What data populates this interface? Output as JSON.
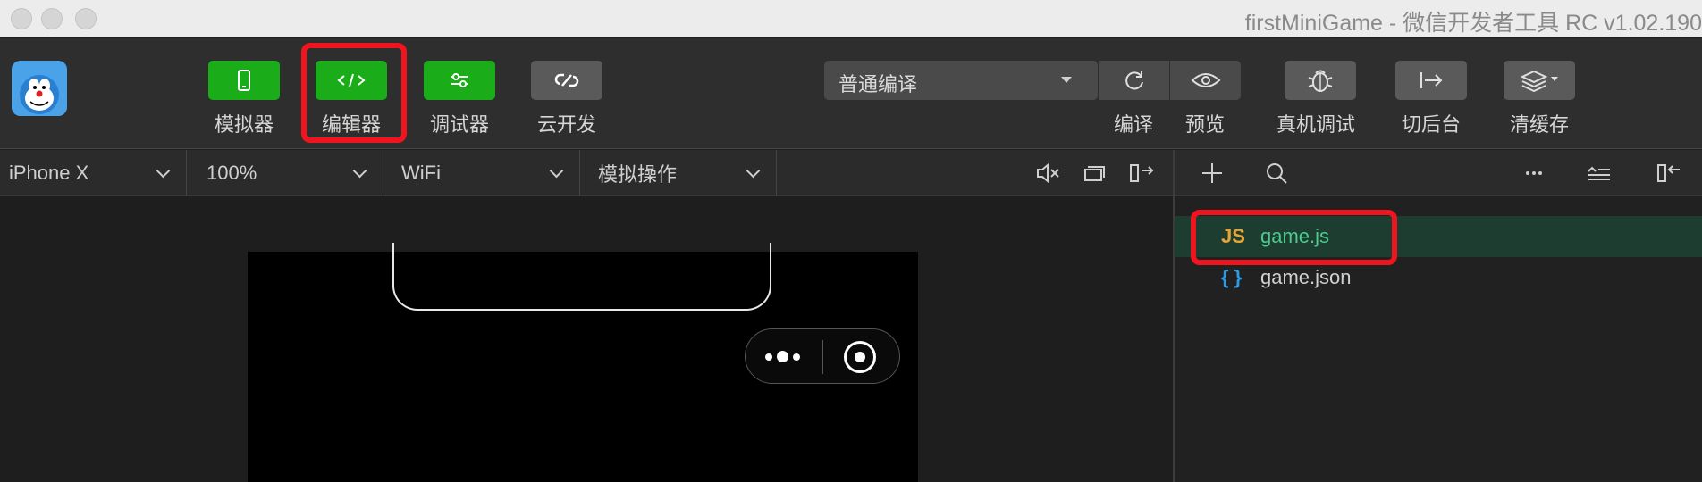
{
  "window": {
    "title": "firstMiniGame - 微信开发者工具 RC v1.02.190"
  },
  "toolbar": {
    "left_buttons": [
      {
        "label": "模拟器",
        "icon": "phone-icon"
      },
      {
        "label": "编辑器",
        "icon": "code-icon"
      },
      {
        "label": "调试器",
        "icon": "sliders-icon"
      },
      {
        "label": "云开发",
        "icon": "cloud-link-icon"
      }
    ],
    "compile_mode": "普通编译",
    "right_buttons": [
      {
        "label": "编译",
        "icon": "refresh-icon"
      },
      {
        "label": "预览",
        "icon": "eye-icon"
      },
      {
        "label": "真机调试",
        "icon": "bug-icon"
      },
      {
        "label": "切后台",
        "icon": "switch-background-icon"
      },
      {
        "label": "清缓存",
        "icon": "layers-icon"
      }
    ]
  },
  "device_bar": {
    "device": "iPhone X",
    "zoom": "100%",
    "network": "WiFi",
    "operation": "模拟操作"
  },
  "file_tree": {
    "files": [
      {
        "name": "game.js",
        "type_icon": "JS",
        "selected": true
      },
      {
        "name": "game.json",
        "type_icon": "{ }",
        "selected": false
      }
    ]
  },
  "colors": {
    "green_button": "#1aad19",
    "highlight_red": "#f0141e",
    "js_icon": "#e6a532",
    "json_icon": "#2b9be6",
    "selected_file_text": "#4ec98f"
  }
}
